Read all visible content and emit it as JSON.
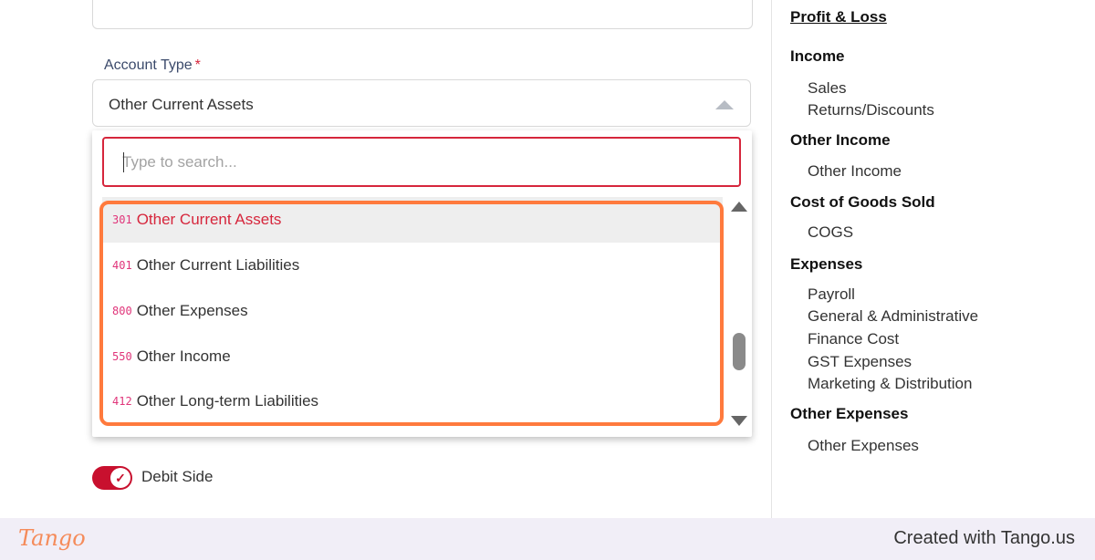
{
  "form": {
    "account_type_label": "Account Type",
    "required_marker": "*",
    "selected_value": "Other Current Assets",
    "search": {
      "placeholder": "Type to search...",
      "value": ""
    },
    "options": [
      {
        "code": "301",
        "label": "Other Current Assets",
        "selected": true
      },
      {
        "code": "401",
        "label": "Other Current Liabilities",
        "selected": false
      },
      {
        "code": "800",
        "label": "Other Expenses",
        "selected": false
      },
      {
        "code": "550",
        "label": "Other Income",
        "selected": false
      },
      {
        "code": "412",
        "label": "Other Long-term Liabilities",
        "selected": false
      }
    ],
    "debit_side": {
      "label": "Debit Side",
      "checked": true
    }
  },
  "sidebar": {
    "title": "Profit & Loss",
    "sections": [
      {
        "heading": "Income",
        "items": [
          "Sales",
          "Returns/Discounts"
        ]
      },
      {
        "heading": "Other Income",
        "items": [
          "Other Income"
        ]
      },
      {
        "heading": "Cost of Goods Sold",
        "items": [
          "COGS"
        ]
      },
      {
        "heading": "Expenses",
        "items": [
          "Payroll",
          "General & Administrative",
          "Finance Cost",
          "GST Expenses",
          "Marketing & Distribution"
        ]
      },
      {
        "heading": "Other Expenses",
        "items": [
          "Other Expenses"
        ]
      }
    ]
  },
  "footer": {
    "logo_text": "Tango",
    "created_with": "Created with Tango.us"
  },
  "colors": {
    "accent": "#d6263c",
    "toggle": "#c8102e",
    "highlight": "#ff7a3d",
    "code": "#e0357a",
    "footer_bg": "#f1eef7"
  }
}
